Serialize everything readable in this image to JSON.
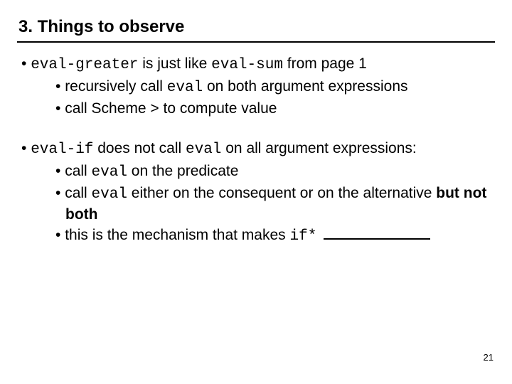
{
  "title": "3. Things to observe",
  "bullets": {
    "b1": {
      "code1": "eval-greater",
      "mid1": " is just like ",
      "code2": "eval-sum",
      "tail": " from page 1",
      "sub1a": "recursively call ",
      "sub1a_code": "eval",
      "sub1a_tail": " on both argument expressions",
      "sub2": "call Scheme > to compute value"
    },
    "b2": {
      "code1": "eval-if",
      "mid1": " does not call ",
      "code2": "eval",
      "tail": " on all argument expressions:",
      "sub1a": "call ",
      "sub1a_code": "eval",
      "sub1a_tail": " on the predicate",
      "sub2a": "call ",
      "sub2a_code": "eval",
      "sub2a_tail": " either on the consequent or on the alternative ",
      "sub2a_bold": "but not both",
      "sub3a": "this is the mechanism that makes ",
      "sub3a_code": "if*",
      "sub3a_tail": " "
    }
  },
  "page_number": "21"
}
